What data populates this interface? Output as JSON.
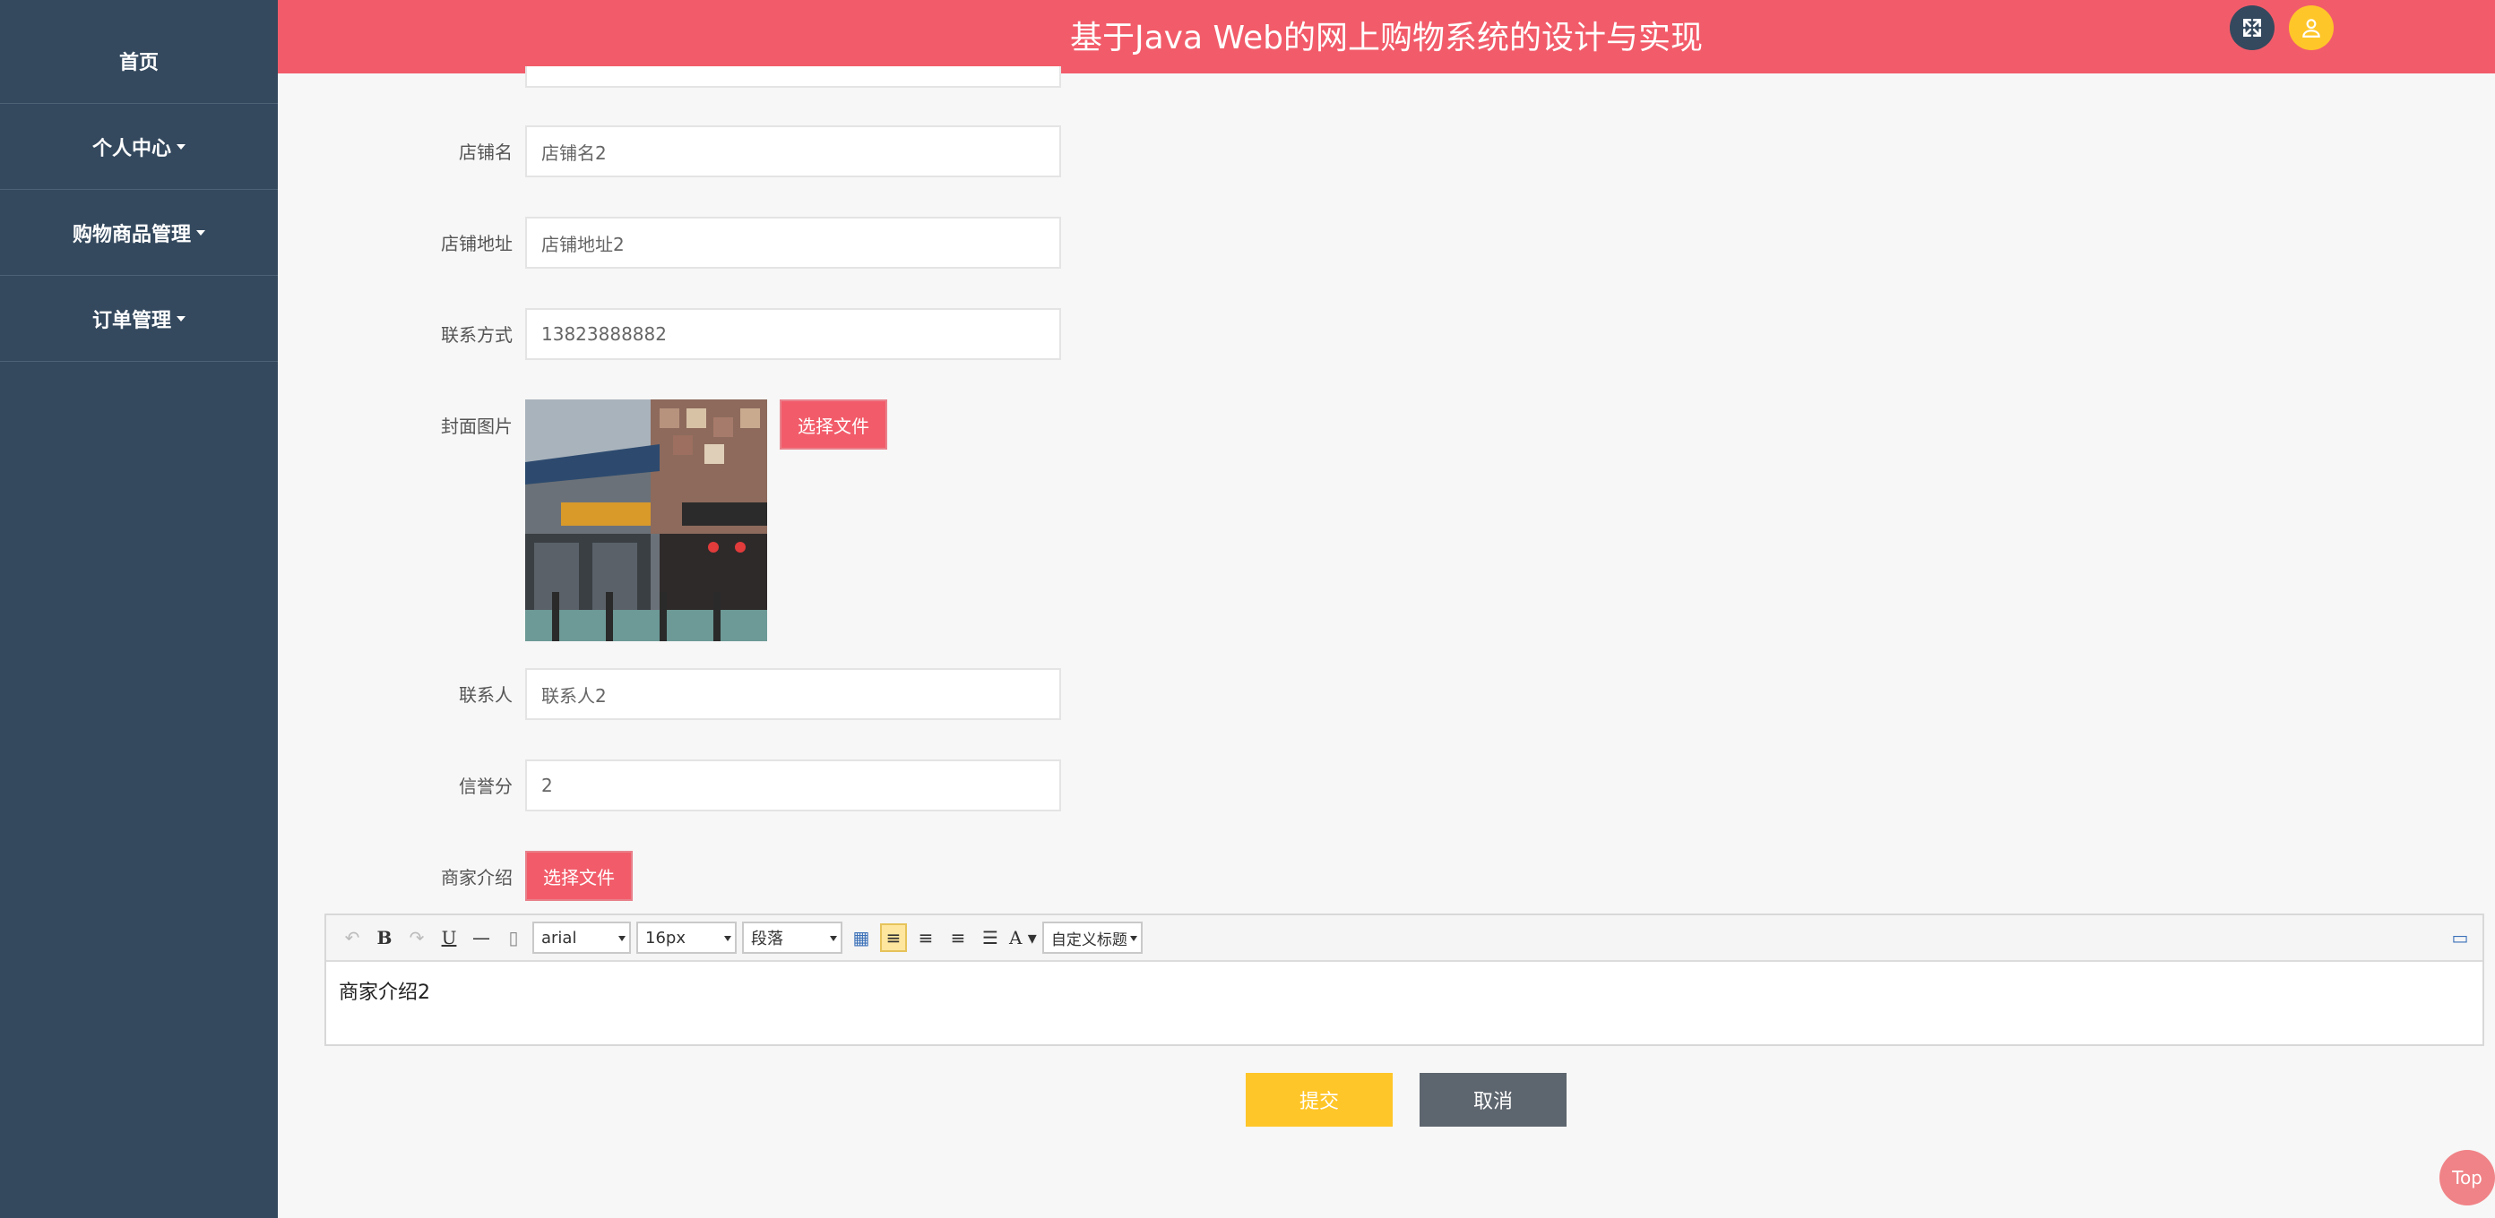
{
  "sidebar": {
    "items": [
      {
        "label": "首页"
      },
      {
        "label": "个人中心"
      },
      {
        "label": "购物商品管理"
      },
      {
        "label": "订单管理"
      }
    ]
  },
  "header": {
    "title": "基于Java Web的网上购物系统的设计与实现"
  },
  "form": {
    "shop_name_label": "店铺名",
    "shop_name_value": "店铺名2",
    "shop_address_label": "店铺地址",
    "shop_address_value": "店铺地址2",
    "contact_label": "联系方式",
    "contact_value": "13823888882",
    "cover_label": "封面图片",
    "choose_file_label": "选择文件",
    "contact_person_label": "联系人",
    "contact_person_value": "联系人2",
    "credit_label": "信誉分",
    "credit_value": "2",
    "intro_label": "商家介绍",
    "intro_choose_file_label": "选择文件"
  },
  "editor": {
    "font_family": "arial",
    "font_size": "16px",
    "paragraph": "段落",
    "custom_title": "自定义标题",
    "content": "商家介绍2"
  },
  "actions": {
    "submit_label": "提交",
    "cancel_label": "取消",
    "top_label": "Top"
  }
}
